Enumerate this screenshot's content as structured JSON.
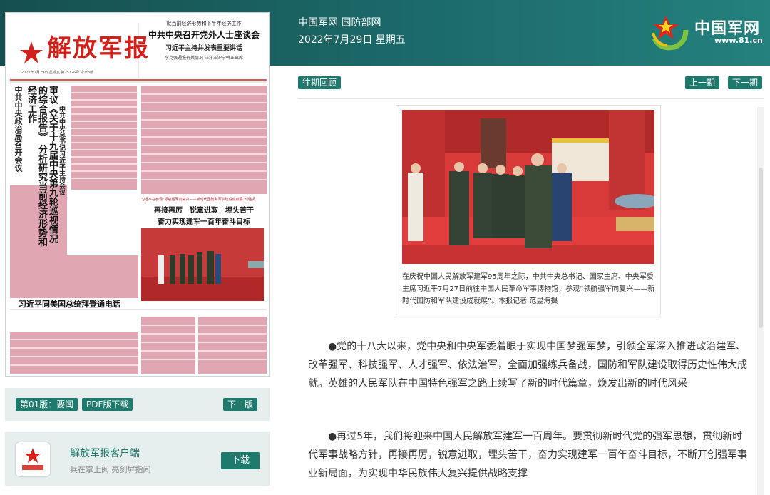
{
  "header": {
    "site_links": "中国军网 国防部网",
    "date": "2022年7月29日 星期五",
    "logo_text": "中国军网",
    "logo_url": "www.81.cn",
    "colors": {
      "header": "#1c6a6a",
      "button": "#1f7a6e"
    }
  },
  "newspaper": {
    "masthead": "解放军报",
    "issue_info": "2022年7月29日 星期五  第25126号  今日8版",
    "top_kicker": "就当前经济形势和下半年经济工作",
    "top_headline": "中共中央召开党外人士座谈会",
    "top_sub": "习近平主持并发表重要讲话",
    "top_sub2": "李克强通报有关情况  汪洋王沪宁韩正出席",
    "side_headline": "中共中央政治局召开会议",
    "main_headline": "审议《关于十九届中央第九轮巡视情况的综合报告》 分析研究当前经济形势和经济工作",
    "col_headline": "中共中央总书记习近平主持会议",
    "mid_kicker": "习近平在参观“领航强军向复兴——新时代国防和军队建设成就展”时强调",
    "mid_headline1": "再接再厉　锐意进取　埋头苦干",
    "mid_headline2": "奋力实现建军一百年奋斗目标",
    "bottom_headline": "习近平同美国总统拜登通电话"
  },
  "toolbar": {
    "edition_label": "第01版：要闻",
    "pdf_label": "PDF版下载",
    "next_edition_label": "下一版",
    "archive_label": "往期回顾",
    "prev_issue_label": "上一期",
    "next_issue_label": "下一期"
  },
  "client": {
    "title": "解放军报客户端",
    "subtitle": "兵在掌上阅 亮剑屏指间",
    "download_label": "下载"
  },
  "article": {
    "photo_caption": "在庆祝中国人民解放军建军95周年之际，中共中央总书记、国家主席、中央军委主席习近平7月27日前往中国人民革命军事博物馆，参观“领航强军向复兴——新时代国防和军队建设成就展”。本报记者 范昱海摄",
    "paragraphs": [
      "●党的十八大以来，党中央和中央军委着眼于实现中国梦强军梦，引领全军深入推进政治建军、改革强军、科技强军、人才强军、依法治军，全面加强练兵备战，国防和军队建设取得历史性伟大成就。英雄的人民军队在中国特色强军之路上续写了新的时代篇章，焕发出新的时代风采",
      "●再过5年，我们将迎来中国人民解放军建军一百周年。要贯彻新时代党的强军思想，贯彻新时代军事战略方针，再接再厉，锐意进取，埋头苦干，奋力实现建军一百年奋斗目标，不断开创强军事业新局面，为实现中华民族伟大复兴提供战略支撑"
    ]
  }
}
